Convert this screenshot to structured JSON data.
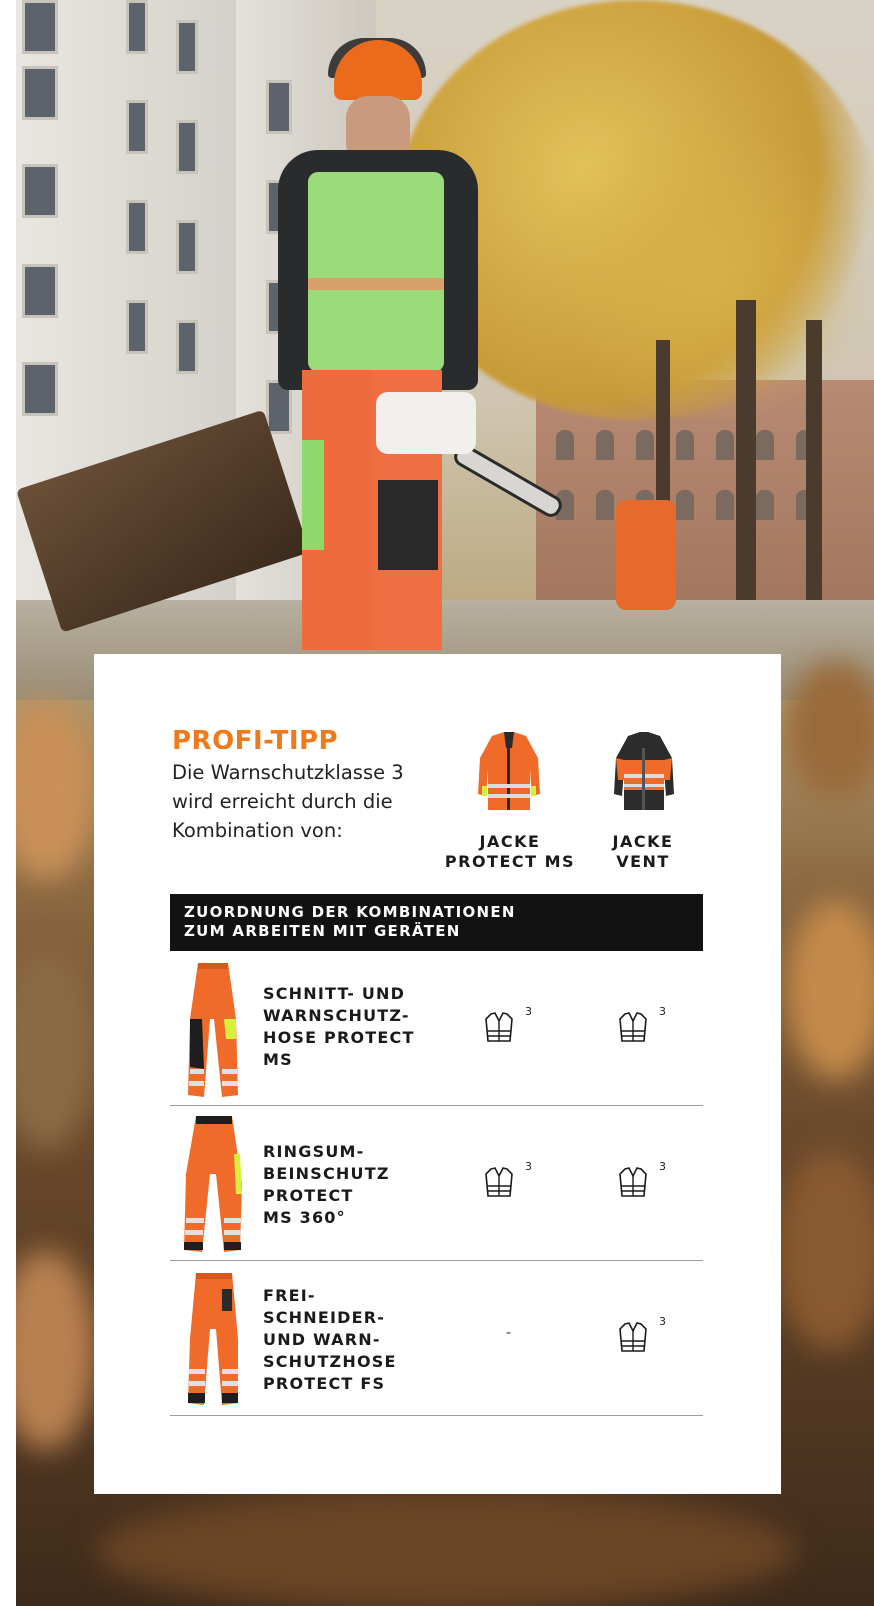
{
  "profi_tipp": {
    "title": "PROFI-TIPP",
    "text_line1": "Die Warnschutzklasse 3",
    "text_line2": "wird erreicht durch die",
    "text_line3": "Kombination von:"
  },
  "jackets": [
    {
      "label": "JACKE\nPROTECT MS",
      "icon": "orange-hi-vis-jacket"
    },
    {
      "label": "JACKE\nVENT",
      "icon": "orange-black-vent-jacket"
    }
  ],
  "table": {
    "header": "ZUORDNUNG DER KOMBINATIONEN\nZUM ARBEITEN MIT GERÄTEN",
    "rows": [
      {
        "label": "SCHNITT- UND\nWARNSCHUTZ-\nHOSE PROTECT\nMS",
        "col1": "3",
        "col2": "3"
      },
      {
        "label": "RINGSUM-\nBEINSCHUTZ\nPROTECT\nMS 360°",
        "col1": "3",
        "col2": "3"
      },
      {
        "label": "FREI-\nSCHNEIDER-\nUND WARN-\nSCHUTZHOSE\nPROTECT FS",
        "col1": "-",
        "col2": "3"
      }
    ]
  },
  "colors": {
    "accent_orange": "#ef7a1c",
    "header_bar": "#121212",
    "hi_vis_orange": "#f06a2a",
    "hi_vis_yellow": "#d6f03c"
  },
  "icons": {
    "class_icon": "safety-vest-icon"
  }
}
